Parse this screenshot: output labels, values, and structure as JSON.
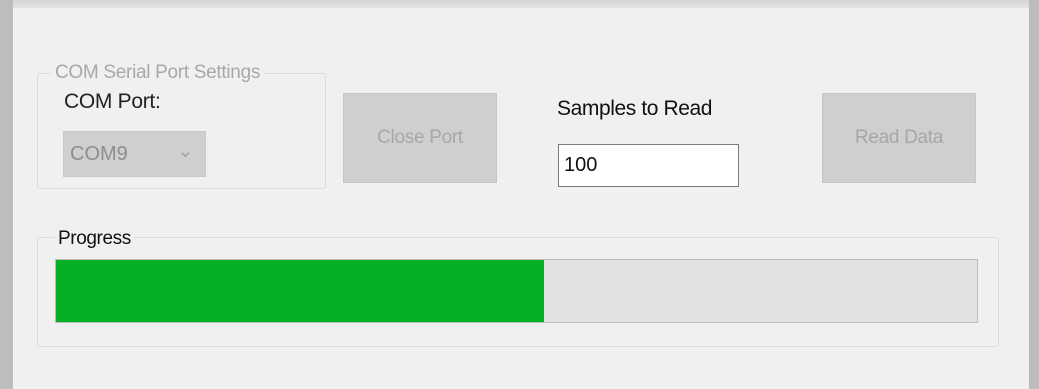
{
  "com_settings": {
    "group_title": "COM Serial Port Settings",
    "port_label": "COM Port:",
    "selected_port": "COM9",
    "close_port_label": "Close Port"
  },
  "samples": {
    "label": "Samples to Read",
    "value": "100"
  },
  "read_data_label": "Read Data",
  "progress": {
    "title": "Progress",
    "fraction": 0.53,
    "fill_color": "#06b025"
  },
  "colors": {
    "disabled_text": "#a7a7a7",
    "disabled_control": "#cfcfcf",
    "background": "#f0f0f0"
  }
}
